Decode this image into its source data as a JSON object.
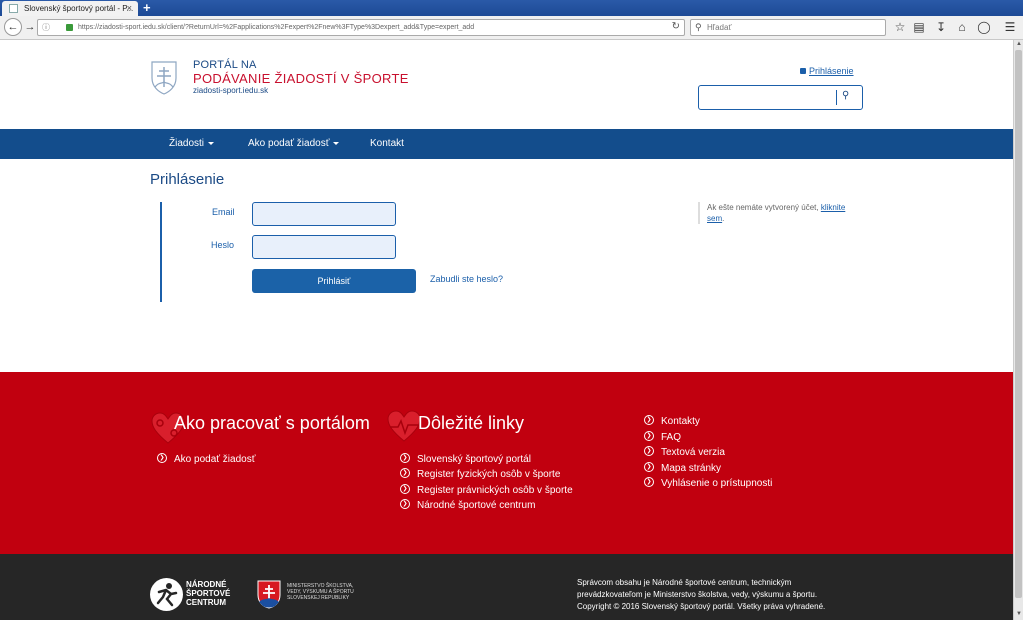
{
  "browser": {
    "tab_title": "Slovenský športový portál - P...",
    "tab_close": "×",
    "new_tab": "+",
    "url": "https://ziadosti-sport.iedu.sk/client/?ReturnUrl=%2Fapplications%2Fexpert%2Fnew%3FType%3Dexpert_add&Type=expert_add",
    "search_placeholder": "Hľadať"
  },
  "header": {
    "logo_line1": "PORTÁL NA",
    "logo_line2": "PODÁVANIE ŽIADOSTÍ V ŠPORTE",
    "logo_line3": "ziadosti-sport.iedu.sk",
    "login_link": "Prihlásenie"
  },
  "menu": {
    "items": [
      {
        "label": "Žiadosti"
      },
      {
        "label": "Ako podať žiadosť"
      },
      {
        "label": "Kontakt"
      }
    ]
  },
  "login": {
    "title": "Prihlásenie",
    "email_label": "Email",
    "password_label": "Heslo",
    "submit_label": "Prihlásiť",
    "forgot_link": "Zabudli ste heslo?",
    "side_text": "Ak ešte nemáte vytvorený účet, ",
    "side_link": "kliknite sem",
    "side_end": "."
  },
  "footer": {
    "col1_heading": "Ako pracovať s portálom",
    "col1_links": [
      "Ako podať žiadosť"
    ],
    "col2_heading": "Dôležité linky",
    "col2_links": [
      "Slovenský športový portál",
      "Register fyzických osôb v športe",
      "Register právnických osôb v športe",
      "Národné športové centrum"
    ],
    "col3_links": [
      "Kontakty",
      "FAQ",
      "Textová verzia",
      "Mapa stránky",
      "Vyhlásenie o prístupnosti"
    ]
  },
  "bottom": {
    "nsc_line1": "NÁRODNÉ",
    "nsc_line2": "ŠPORTOVÉ",
    "nsc_line3": "CENTRUM",
    "ministry_line1": "MINISTERSTVO ŠKOLSTVA,",
    "ministry_line2": "VEDY, VÝSKUMU A ŠPORTU",
    "ministry_line3": "SLOVENSKEJ REPUBLIKY",
    "copy_line1": "Správcom obsahu je Národné športové centrum, technickým",
    "copy_line2": "prevádzkovateľom je Ministerstvo školstva, vedy, výskumu a športu.",
    "copy_line3": "Copyright © 2016 Slovenský športový portál. Všetky práva vyhradené."
  },
  "colors": {
    "brand_blue": "#134d8c",
    "brand_red": "#c1000f",
    "footer_dark": "#262626"
  }
}
